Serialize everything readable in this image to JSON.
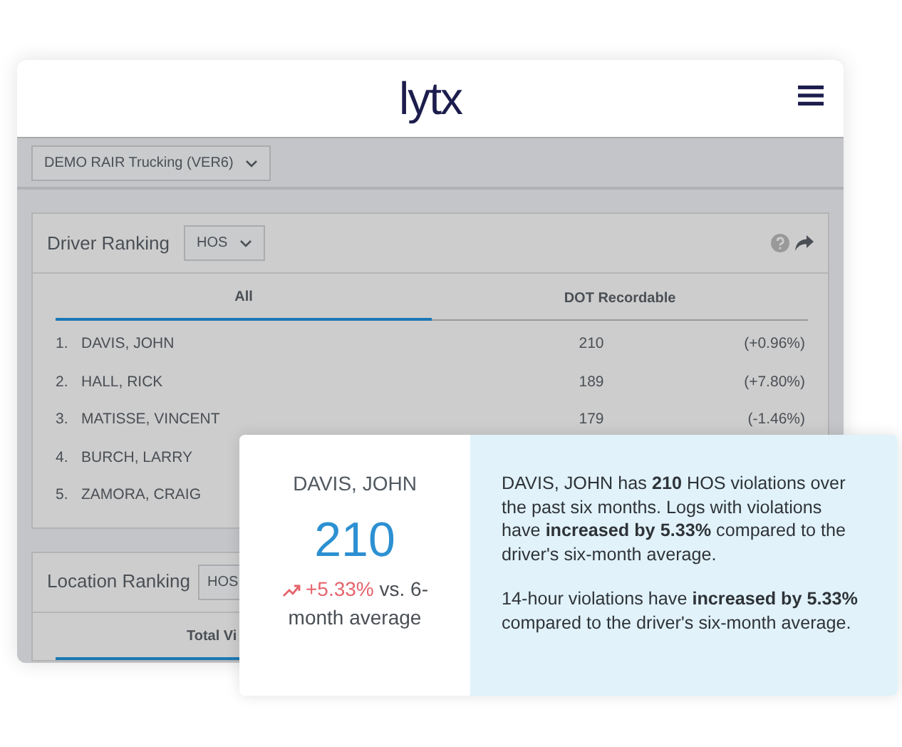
{
  "header": {
    "logo": "lytx"
  },
  "org_select": {
    "value": "DEMO RAIR Trucking (VER6)"
  },
  "driver_ranking": {
    "title": "Driver Ranking",
    "metric": "HOS",
    "tabs": [
      {
        "label": "All",
        "selected": true
      },
      {
        "label": "DOT Recordable",
        "selected": false
      }
    ],
    "rows": [
      {
        "rank": "1.",
        "name": "DAVIS, JOHN",
        "value": "210",
        "change": "(+0.96%)"
      },
      {
        "rank": "2.",
        "name": "HALL, RICK",
        "value": "189",
        "change": "(+7.80%)"
      },
      {
        "rank": "3.",
        "name": "MATISSE, VINCENT",
        "value": "179",
        "change": "(-1.46%)"
      },
      {
        "rank": "4.",
        "name": "BURCH, LARRY"
      },
      {
        "rank": "5.",
        "name": "ZAMORA, CRAIG"
      }
    ]
  },
  "location_ranking": {
    "title": "Location Ranking",
    "metric": "HOS",
    "tabs": [
      {
        "label": "Total Vi",
        "selected": true
      }
    ]
  },
  "popup": {
    "name": "DAVIS, JOHN",
    "value": "210",
    "change": "+5.33%",
    "comparison": "vs. 6-month average",
    "paragraphs": [
      "DAVIS, JOHN has **210** HOS violations over the past six months. Logs with violations have **increased by 5.33%** compared to the driver's six-month average.",
      "14-hour violations have **increased by 5.33%** compared to the driver's six-month average."
    ]
  }
}
